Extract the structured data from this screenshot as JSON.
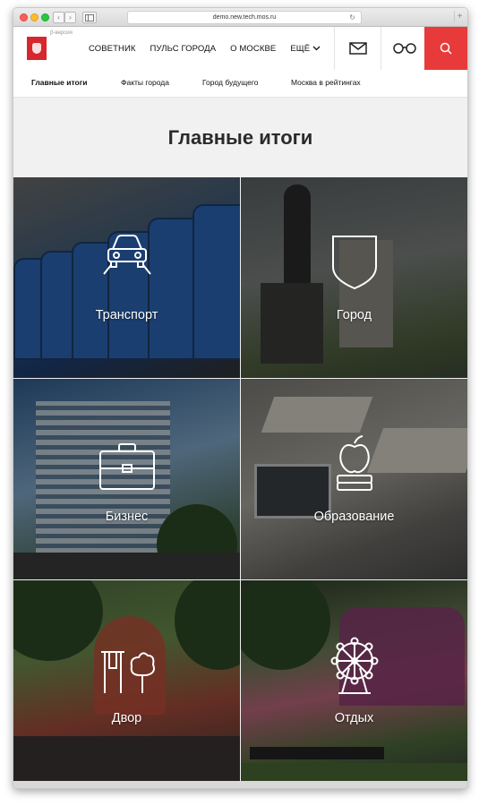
{
  "browser": {
    "address": "demo.new.tech.mos.ru",
    "back_glyph": "‹",
    "forward_glyph": "›",
    "reload_glyph": "↻",
    "new_tab_glyph": "+"
  },
  "header": {
    "beta_label": "β-версия",
    "nav": [
      "СОВЕТНИК",
      "ПУЛЬС ГОРОДА",
      "О МОСКВЕ",
      "ЕЩЁ"
    ],
    "accent_color": "#e83a3a",
    "icons": [
      "mail-icon",
      "glasses-icon",
      "search-icon"
    ]
  },
  "subnav": {
    "items": [
      "Главные итоги",
      "Факты города",
      "Город будущего",
      "Москва в рейтингах"
    ]
  },
  "page": {
    "title": "Главные итоги"
  },
  "tiles": [
    {
      "label": "Транспорт",
      "icon": "car-icon"
    },
    {
      "label": "Город",
      "icon": "crest-icon"
    },
    {
      "label": "Бизнес",
      "icon": "briefcase-icon"
    },
    {
      "label": "Образование",
      "icon": "apple-books-icon"
    },
    {
      "label": "Двор",
      "icon": "playground-icon"
    },
    {
      "label": "Отдых",
      "icon": "ferris-wheel-icon"
    }
  ]
}
